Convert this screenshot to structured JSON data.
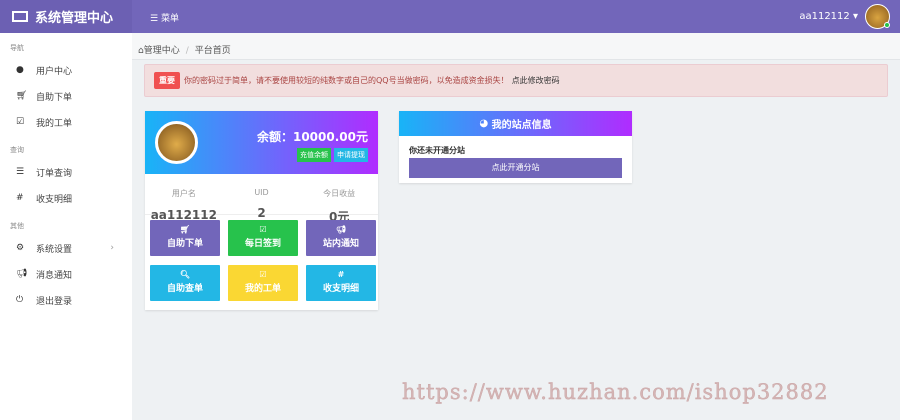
{
  "header": {
    "brand": "系统管理中心",
    "menu_label": "菜单",
    "username": "aa112112"
  },
  "sidebar": {
    "sections": [
      {
        "title": "导航",
        "items": [
          {
            "label": "用户中心",
            "icon": "user-icon"
          },
          {
            "label": "自助下单",
            "icon": "cart-icon"
          },
          {
            "label": "我的工单",
            "icon": "check-square-icon"
          }
        ]
      },
      {
        "title": "查询",
        "items": [
          {
            "label": "订单查询",
            "icon": "list-icon"
          },
          {
            "label": "收支明细",
            "icon": "hash-icon"
          }
        ]
      },
      {
        "title": "其他",
        "items": [
          {
            "label": "系统设置",
            "icon": "settings-icon"
          },
          {
            "label": "消息通知",
            "icon": "bullhorn-icon"
          },
          {
            "label": "退出登录",
            "icon": "power-icon"
          }
        ]
      }
    ]
  },
  "breadcrumb": {
    "home": "管理中心",
    "current": "平台首页"
  },
  "alert": {
    "badge": "重要",
    "message": "你的密码过于简单，请不要使用较短的纯数字或自己的QQ号当做密码，以免造成资金损失！",
    "link": "点此修改密码"
  },
  "user_card": {
    "balance": "余额：10000.00元",
    "recharge": "充值余额",
    "withdraw": "申请提现",
    "stats": [
      {
        "label": "用户名",
        "value": "aa112112"
      },
      {
        "label": "UID",
        "value": "2"
      },
      {
        "label": "今日收益",
        "value": "0元"
      }
    ],
    "tiles": [
      {
        "label": "自助下单",
        "icon": "cart-icon",
        "color": "#7266ba"
      },
      {
        "label": "每日签到",
        "icon": "check-icon",
        "color": "#27c24c"
      },
      {
        "label": "站内通知",
        "icon": "bullhorn-icon",
        "color": "#7266ba"
      },
      {
        "label": "自助查单",
        "icon": "search-icon",
        "color": "#23b7e5"
      },
      {
        "label": "我的工单",
        "icon": "edit-icon",
        "color": "#fad733"
      },
      {
        "label": "收支明细",
        "icon": "hash-icon",
        "color": "#23b7e5"
      }
    ]
  },
  "site_card": {
    "title": "我的站点信息",
    "text": "你还未开通分站",
    "button": "点此开通分站"
  },
  "watermark": "https://www.huzhan.com/ishop32882"
}
